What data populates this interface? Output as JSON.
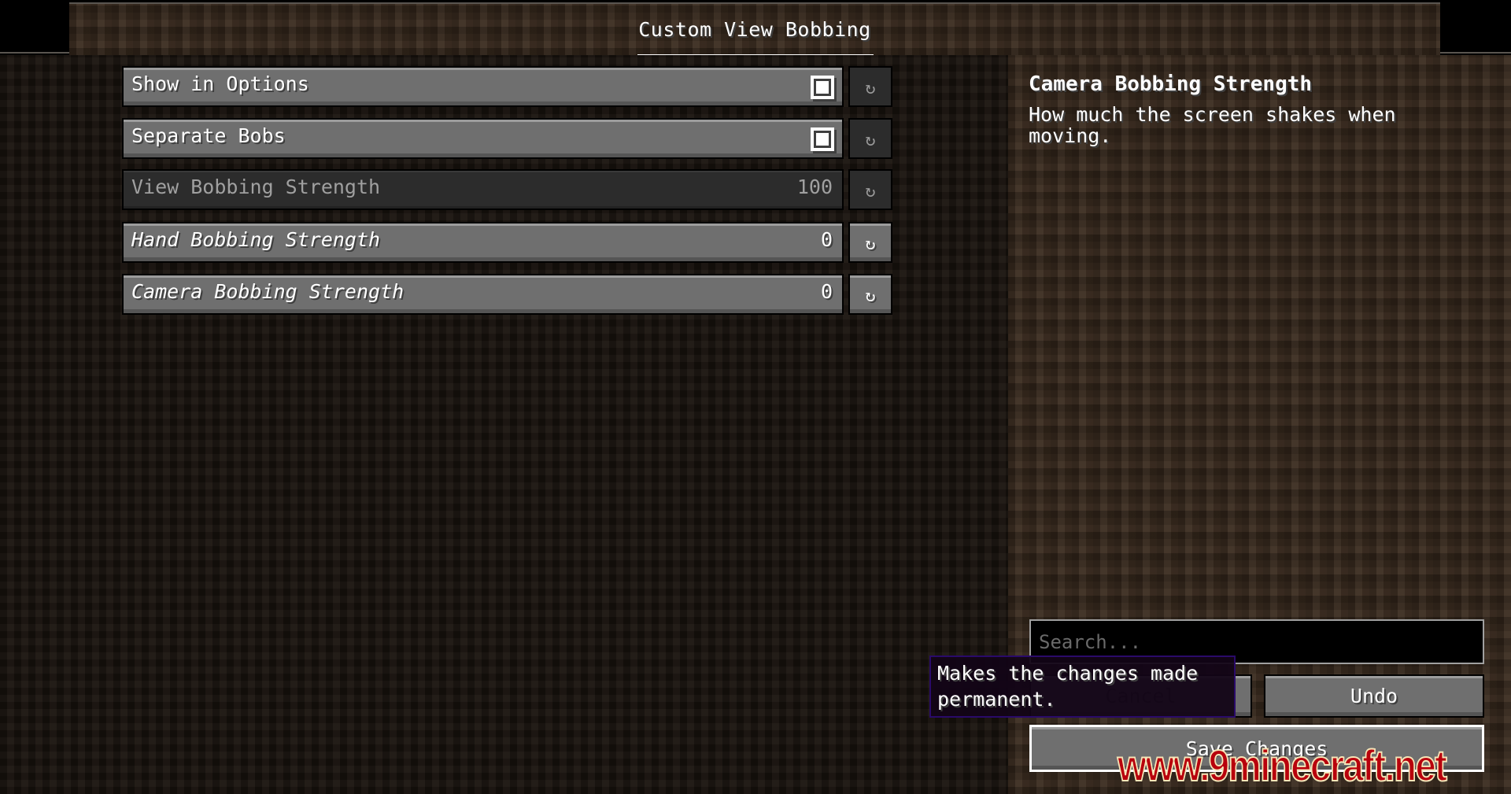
{
  "header": {
    "title": "Custom View Bobbing"
  },
  "options": [
    {
      "label": "Show in Options",
      "type": "toggle",
      "checked": true,
      "italic": false,
      "disabled": false,
      "reset_active": false
    },
    {
      "label": "Separate Bobs",
      "type": "toggle",
      "checked": true,
      "italic": false,
      "disabled": false,
      "reset_active": false
    },
    {
      "label": "View Bobbing Strength",
      "type": "value",
      "value": "100",
      "italic": false,
      "disabled": true,
      "reset_active": false
    },
    {
      "label": "Hand Bobbing Strength",
      "type": "value",
      "value": "0",
      "italic": true,
      "disabled": false,
      "reset_active": true
    },
    {
      "label": "Camera Bobbing Strength",
      "type": "value",
      "value": "0",
      "italic": true,
      "disabled": false,
      "reset_active": true
    }
  ],
  "icons": {
    "reset": "reset-icon",
    "reset_glyph": "↻"
  },
  "description": {
    "title": "Camera Bobbing Strength",
    "body": "How much the screen shakes when moving."
  },
  "search": {
    "placeholder": "Search...",
    "value": ""
  },
  "buttons": {
    "cancel": "Cancel",
    "undo": "Undo",
    "save": "Save Changes"
  },
  "tooltip": {
    "text": "Makes the changes made permanent."
  },
  "watermark": {
    "text": "www.9minecraft.net"
  }
}
